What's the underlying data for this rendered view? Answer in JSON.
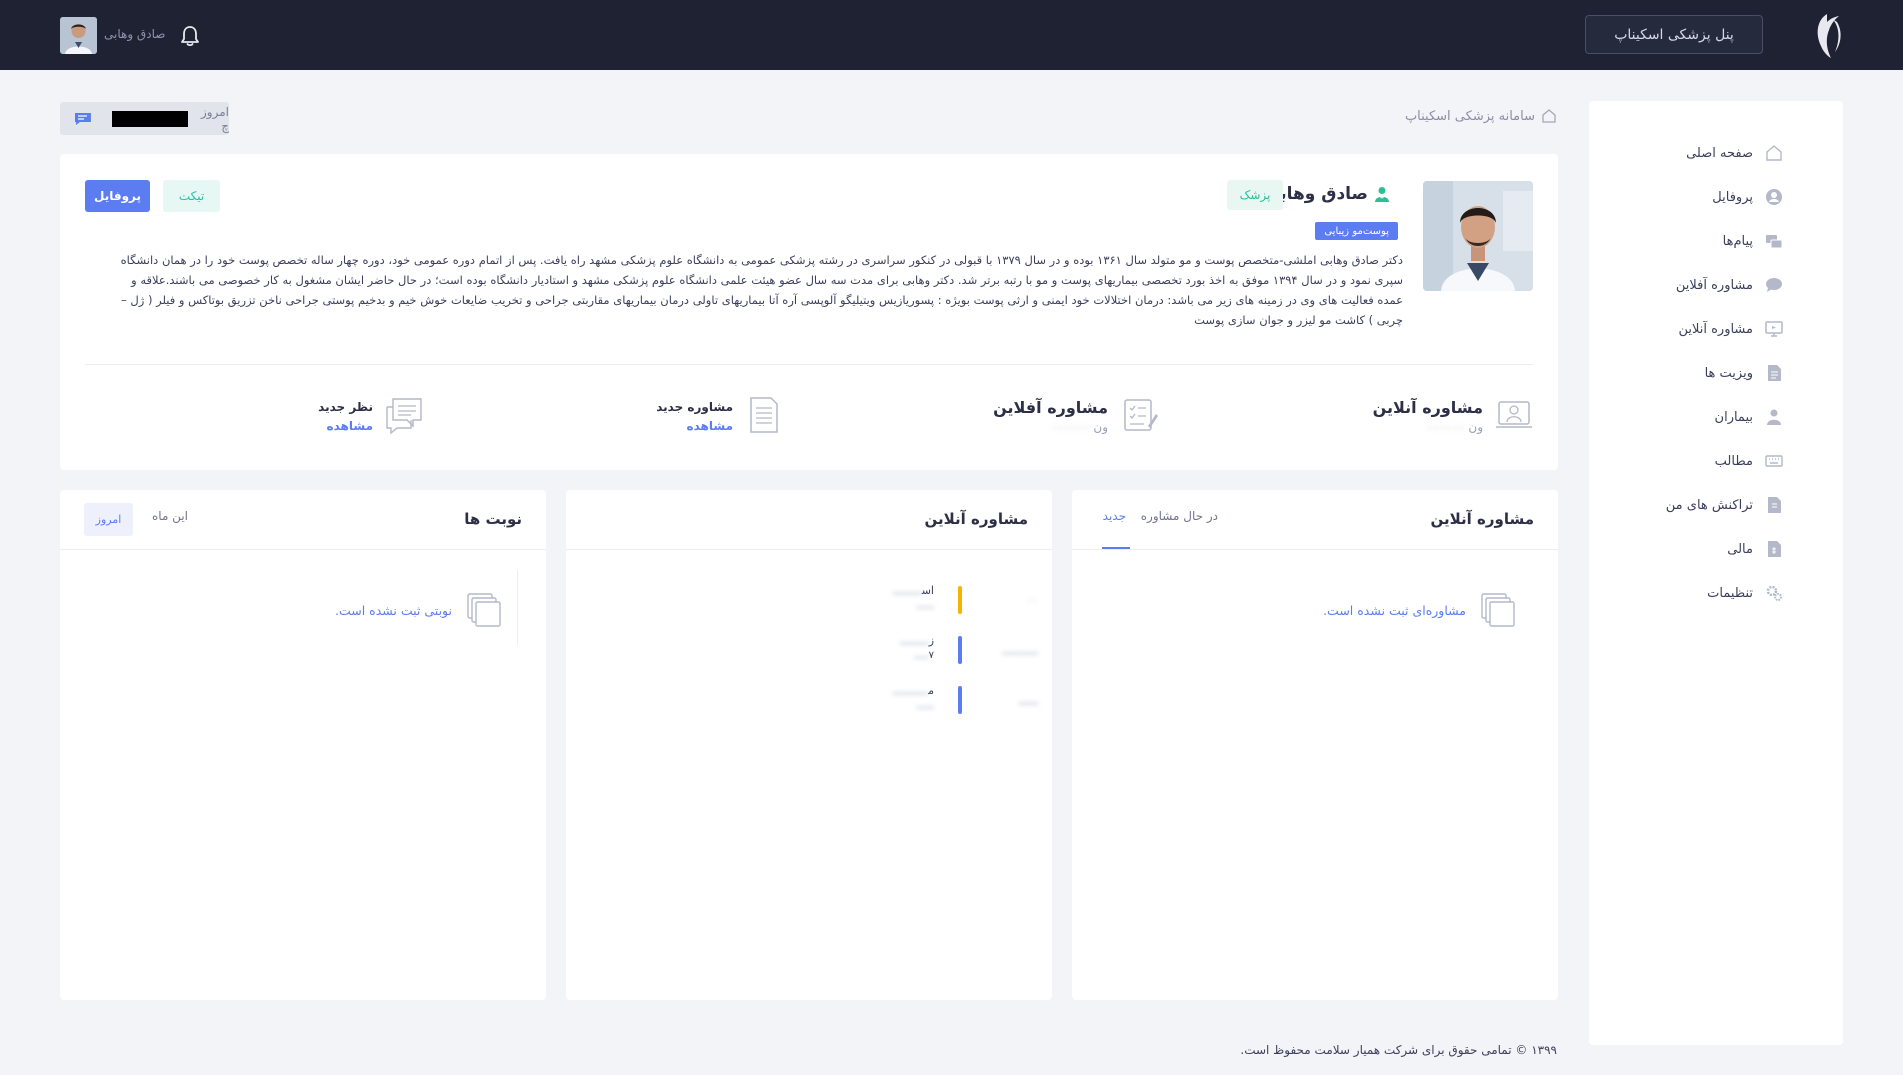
{
  "header": {
    "panel_button": "پنل پزشکی اسکیناپ",
    "user_name": "صادق وهابی"
  },
  "sidebar": {
    "items": [
      {
        "label": "صفحه اصلی",
        "icon": "home-icon"
      },
      {
        "label": "پروفایل",
        "icon": "user-circle-icon"
      },
      {
        "label": "پیام‌ها",
        "icon": "chat-bubbles-icon"
      },
      {
        "label": "مشاوره آفلاین",
        "icon": "message-icon"
      },
      {
        "label": "مشاوره آنلاین",
        "icon": "monitor-icon"
      },
      {
        "label": "ویزیت ها",
        "icon": "document-icon"
      },
      {
        "label": "بیماران",
        "icon": "patient-icon"
      },
      {
        "label": "مطالب",
        "icon": "keyboard-icon"
      },
      {
        "label": "تراکنش های من",
        "icon": "receipt-icon"
      },
      {
        "label": "مالی",
        "icon": "finance-icon"
      },
      {
        "label": "تنظیمات",
        "icon": "gear-icon"
      }
    ]
  },
  "breadcrumb": {
    "label": "سامانه پزشکی اسکیناپ"
  },
  "today_chip": {
    "label": "امروز چ"
  },
  "profile": {
    "name": "صادق وهابی",
    "role": "پزشک",
    "specialty": "پوست‌مو زیبایی",
    "bio": "دکتر صادق وهابی املشی-متخصص پوست و مو متولد سال ۱۳۶۱ بوده و در سال ۱۳۷۹ با قبولی در کنکور سراسری در رشته پزشکی عمومی به دانشگاه علوم پزشکی مشهد راه یافت. پس از اتمام دوره عمومی خود، دوره چهار ساله تخصص پوست خود را در همان دانشگاه سپری نمود و در سال ۱۳۹۴ موفق به اخذ بورد تخصصی بیماریهای پوست و مو با رتبه برتر شد. دکتر وهابی برای مدت سه سال عضو هیئت علمی دانشگاه علوم پزشکی مشهد و استادیار دانشگاه بوده است؛ در حال حاضر ایشان مشغول به کار خصوصی می باشند.علاقه و عمده فعالیت های وی در زمینه های زیر می باشد: درمان اختلالات خود ایمنی و ارثی پوست بویژه : پسوریازیس ویتیلیگو آلوپسی آره آتا بیماریهای تاولی درمان بیماریهای مقاربتی جراحی و تخریب ضایعات خوش خیم و بدخیم پوستی جراحی ناخن تزریق بوتاکس و فیلر ( ژل – چربی ) کاشت مو لیزر و جوان سازی پوست",
    "ticket_button": "تیکت",
    "profile_button": "پروفایل"
  },
  "stats": {
    "online": {
      "title": "مشاوره آنلاین",
      "sub": "ون"
    },
    "offline": {
      "title": "مشاوره آفلاین",
      "sub": "ون"
    },
    "new_consult": {
      "title": "مشاوره جدید",
      "link": "مشاهده"
    },
    "new_comment": {
      "title": "نظر جدید",
      "link": "مشاهده"
    }
  },
  "panel_offline": {
    "title": "مشاوره آنلاین",
    "tabs": [
      "جدید",
      "در حال مشاوره"
    ],
    "empty": "مشاوره‌ای ثبت نشده است."
  },
  "panel_online": {
    "title": "مشاوره آنلاین",
    "rows": [
      {
        "name": "اس",
        "bar_color": "#f4b400"
      },
      {
        "name": "ز",
        "sub": "۷",
        "bar_color": "#5c7cf2"
      },
      {
        "name": "م",
        "bar_color": "#5c7cf2"
      }
    ]
  },
  "panel_turns": {
    "title": "نوبت ها",
    "tabs": [
      "امروز",
      "این ماه"
    ],
    "empty": "نوبتی ثبت نشده است."
  },
  "footer": {
    "text": "۱۳۹۹ © تمامی حقوق برای شرکت همیار سلامت محفوظ است."
  },
  "colors": {
    "accent": "#5c7cf2",
    "teal": "#2bbf94",
    "topbar": "#1f2233"
  }
}
